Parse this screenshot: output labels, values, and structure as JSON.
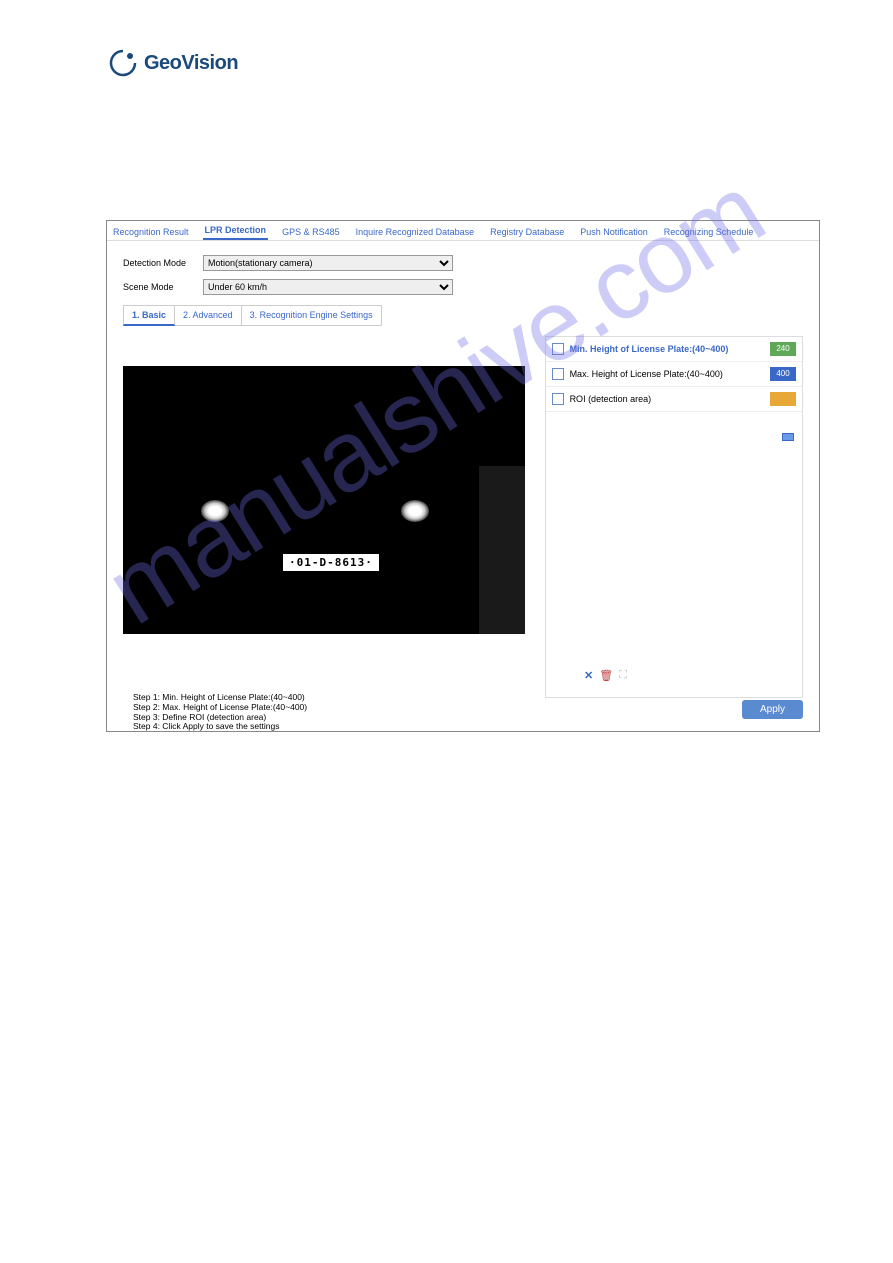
{
  "logo_text": "GeoVision",
  "watermark": "manualshive.com",
  "tabs": {
    "recognition_result": "Recognition Result",
    "lpr_detection": "LPR Detection",
    "gps_rs485": "GPS & RS485",
    "inquire_db": "Inquire Recognized Database",
    "registry_db": "Registry Database",
    "push_notification": "Push Notification",
    "schedule": "Recognizing Schedule"
  },
  "form": {
    "detection_mode_label": "Detection Mode",
    "detection_mode_value": "Motion(stationary camera)",
    "scene_mode_label": "Scene Mode",
    "scene_mode_value": "Under 60 km/h"
  },
  "subtabs": {
    "basic": "1. Basic",
    "advanced": "2. Advanced",
    "engine": "3. Recognition Engine Settings"
  },
  "preview": {
    "plate_text": "·01-D-8613·"
  },
  "side": {
    "min_height_label": "Min. Height of License Plate:(40~400)",
    "min_height_value": "240",
    "max_height_label": "Max. Height of License Plate:(40~400)",
    "max_height_value": "400",
    "roi_label": "ROI (detection area)"
  },
  "steps": {
    "s1": "Step 1: Min. Height of License Plate:(40~400)",
    "s2": "Step 2: Max. Height of License Plate:(40~400)",
    "s3": "Step 3: Define ROI (detection area)",
    "s4": "Step 4: Click Apply to save the settings"
  },
  "apply_label": "Apply",
  "icon_glyphs": {
    "x": "✕",
    "trash": "🗑",
    "expand": "⛶"
  }
}
